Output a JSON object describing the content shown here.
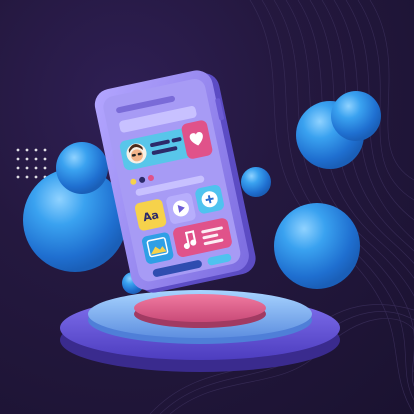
{
  "illustration": {
    "subject": "3d-mobile-app-mockup",
    "phone": {
      "font_tile_text": "Aa",
      "icons": [
        "avatar-icon",
        "heart-icon",
        "play-icon",
        "plus-icon",
        "image-icon",
        "music-note-icon"
      ]
    },
    "colors": {
      "background": "#231838",
      "phone_body": "#9b8cf0",
      "phone_screen": "#a79bf5",
      "bubbles": "#2f8fe6",
      "podium_top": "#e2688f",
      "podium_ring": "#7fb6f2",
      "podium_base": "#6a58e0",
      "accent_pink": "#e0528a",
      "accent_yellow": "#f6d24b",
      "accent_teal": "#45d1c3"
    }
  }
}
